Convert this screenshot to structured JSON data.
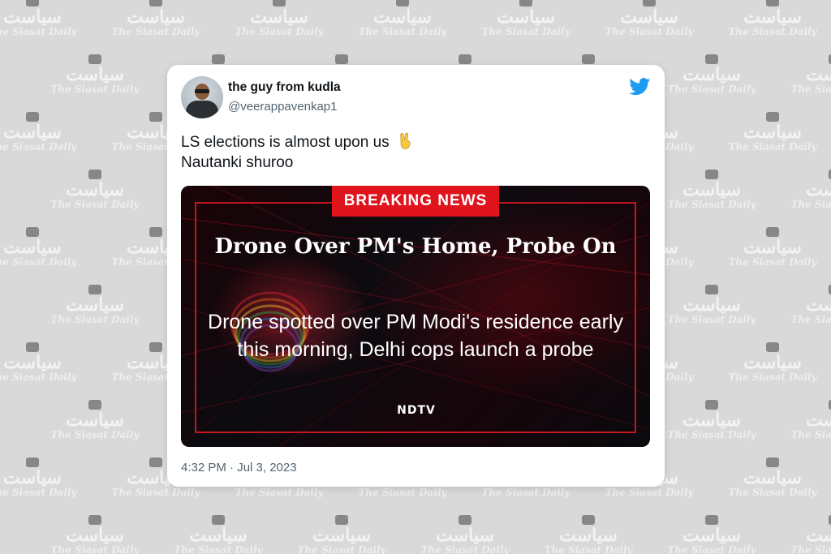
{
  "watermark": {
    "logo_urdu": "سیاست",
    "logo_english": "The Siasat Daily"
  },
  "tweet": {
    "author": {
      "display_name": "the guy from kudla",
      "handle": "@veerappavenkap1",
      "avatar_icon": "avatar-photo"
    },
    "platform_icon": "twitter-bird-icon",
    "text_lines": [
      "LS elections is almost upon us",
      "Nautanki shuroo"
    ],
    "emoji": "victory-hand-emoji",
    "timestamp": "4:32 PM · Jul 3, 2023",
    "colors": {
      "twitter_blue": "#1d9bf0",
      "breaking_red": "#e0141d"
    }
  },
  "media": {
    "badge": "BREAKING NEWS",
    "headline": "Drone Over PM's Home, Probe On",
    "subheadline": "Drone spotted over PM Modi's residence early this morning, Delhi cops launch a probe",
    "source_logo": "NDTV"
  }
}
